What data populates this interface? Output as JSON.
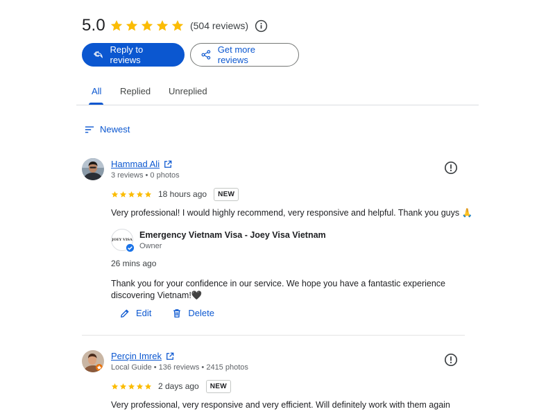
{
  "summary": {
    "rating": "5.0",
    "stars": 5,
    "review_count": "(504 reviews)",
    "star_color": "#fbbc04"
  },
  "actions": {
    "reply_label": "Reply to reviews",
    "get_more_label": "Get more reviews"
  },
  "tabs": [
    {
      "label": "All",
      "active": true
    },
    {
      "label": "Replied",
      "active": false
    },
    {
      "label": "Unreplied",
      "active": false
    }
  ],
  "sort": {
    "label": "Newest"
  },
  "reviews": [
    {
      "name": "Hammad Ali",
      "meta": "3 reviews • 0 photos",
      "stars": 5,
      "time": "18 hours ago",
      "badge": "NEW",
      "text": "Very professional! I would highly recommend, very responsive and helpful. Thank you guys 🙏",
      "reply": {
        "owner_name": "Emergency Vietnam Visa - Joey Visa Vietnam",
        "owner_label": "Owner",
        "logo_text": "JOEY VISA",
        "time": "26 mins ago",
        "text": "Thank you for your confidence in our service. We hope you have a fantastic experience discovering Vietnam!🖤",
        "edit_label": "Edit",
        "delete_label": "Delete"
      }
    },
    {
      "name": "Perçin Imrek",
      "meta": "Local Guide • 136 reviews • 2415 photos",
      "stars": 5,
      "time": "2 days ago",
      "badge": "NEW",
      "text": "Very professional, very responsive and very efficient. Will definitely work with them again"
    }
  ],
  "colors": {
    "accent": "#0b57d0",
    "text": "#202124",
    "muted": "#5f6368"
  }
}
